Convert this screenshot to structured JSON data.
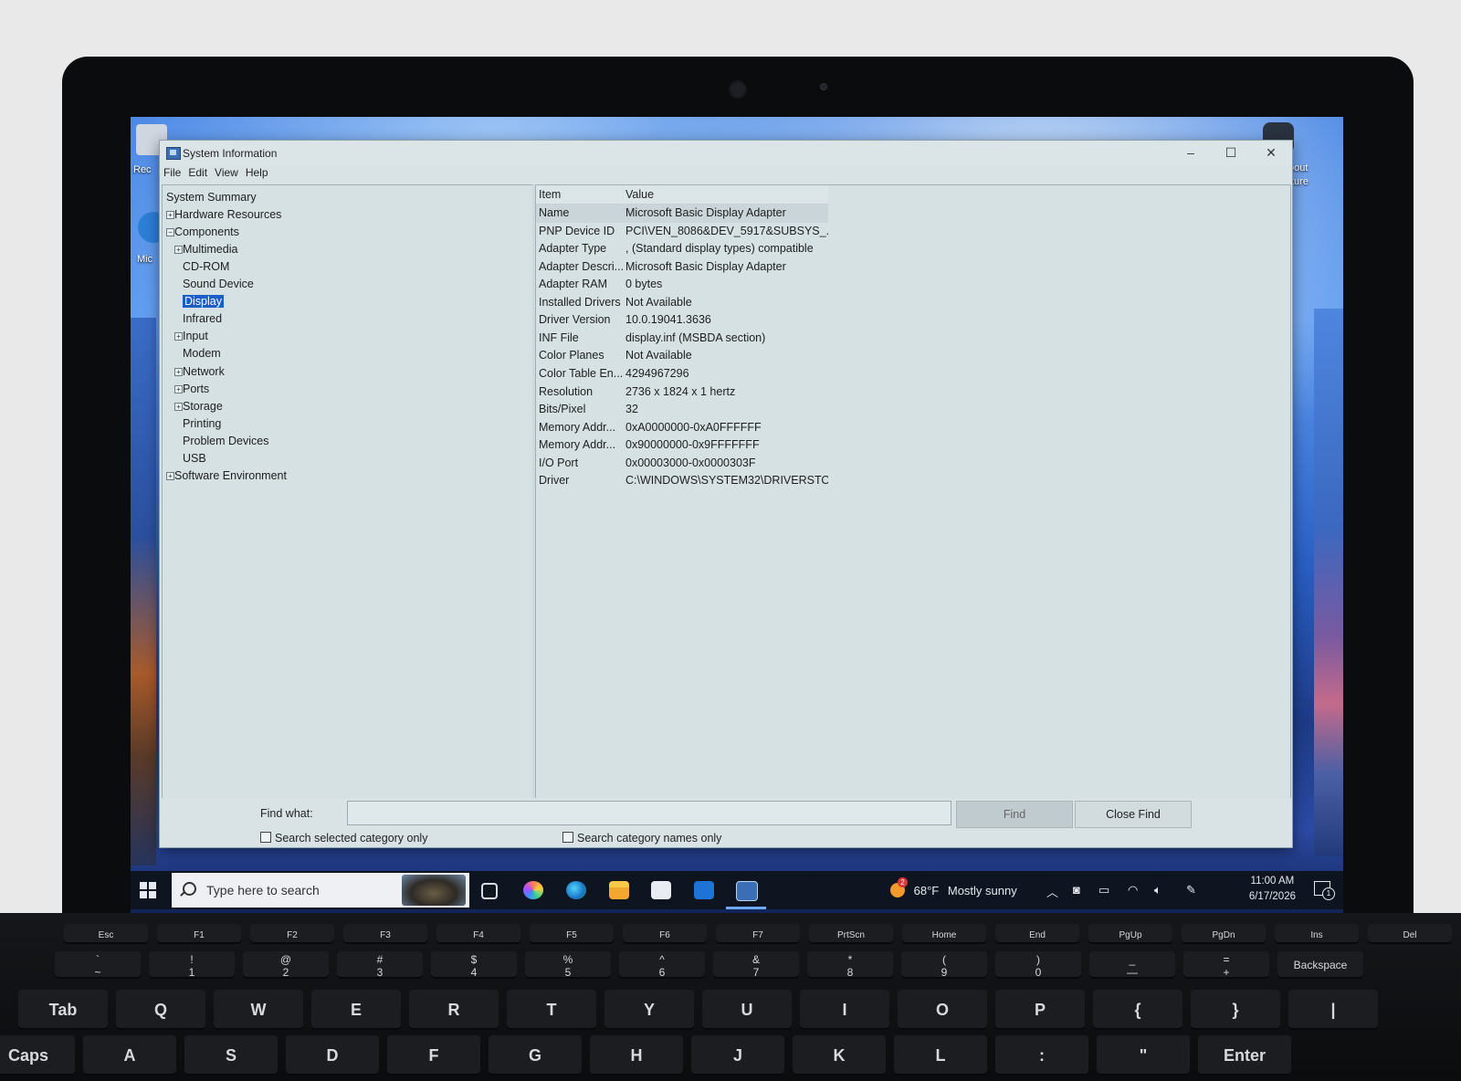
{
  "window": {
    "title": "System Information",
    "menu": [
      "File",
      "Edit",
      "View",
      "Help"
    ],
    "controls": {
      "minimize": "–",
      "maximize": "☐",
      "close": "✕"
    }
  },
  "tree": [
    {
      "label": "System Summary",
      "level": 0,
      "expander": ""
    },
    {
      "label": "Hardware Resources",
      "level": 0,
      "expander": "+"
    },
    {
      "label": "Components",
      "level": 0,
      "expander": "−"
    },
    {
      "label": "Multimedia",
      "level": 1,
      "expander": "+"
    },
    {
      "label": "CD-ROM",
      "level": 1,
      "expander": ""
    },
    {
      "label": "Sound Device",
      "level": 1,
      "expander": ""
    },
    {
      "label": "Display",
      "level": 1,
      "expander": "",
      "selected": true
    },
    {
      "label": "Infrared",
      "level": 1,
      "expander": ""
    },
    {
      "label": "Input",
      "level": 1,
      "expander": "+"
    },
    {
      "label": "Modem",
      "level": 1,
      "expander": ""
    },
    {
      "label": "Network",
      "level": 1,
      "expander": "+"
    },
    {
      "label": "Ports",
      "level": 1,
      "expander": "+"
    },
    {
      "label": "Storage",
      "level": 1,
      "expander": "+"
    },
    {
      "label": "Printing",
      "level": 1,
      "expander": ""
    },
    {
      "label": "Problem Devices",
      "level": 1,
      "expander": ""
    },
    {
      "label": "USB",
      "level": 1,
      "expander": ""
    },
    {
      "label": "Software Environment",
      "level": 0,
      "expander": "+"
    }
  ],
  "details": {
    "columns": [
      "Item",
      "Value"
    ],
    "rows": [
      [
        "Name",
        "Microsoft Basic Display Adapter"
      ],
      [
        "PNP Device ID",
        "PCI\\VEN_8086&DEV_5917&SUBSYS_..."
      ],
      [
        "Adapter Type",
        ", (Standard display types) compatible"
      ],
      [
        "Adapter Descri...",
        "Microsoft Basic Display Adapter"
      ],
      [
        "Adapter RAM",
        "0 bytes"
      ],
      [
        "Installed Drivers",
        "Not Available"
      ],
      [
        "Driver Version",
        "10.0.19041.3636"
      ],
      [
        "INF File",
        "display.inf (MSBDA section)"
      ],
      [
        "Color Planes",
        "Not Available"
      ],
      [
        "Color Table En...",
        "4294967296"
      ],
      [
        "Resolution",
        "2736 x 1824 x 1 hertz"
      ],
      [
        "Bits/Pixel",
        "32"
      ],
      [
        "Memory Addr...",
        "0xA0000000-0xA0FFFFFF"
      ],
      [
        "Memory Addr...",
        "0x90000000-0x9FFFFFFF"
      ],
      [
        "I/O Port",
        "0x00003000-0x0000303F"
      ],
      [
        "Driver",
        "C:\\WINDOWS\\SYSTEM32\\DRIVERSTO..."
      ]
    ]
  },
  "find": {
    "label": "Find what:",
    "value": "",
    "find_button": "Find",
    "close_button": "Close Find",
    "opt_selected": "Search selected category only",
    "opt_names": "Search category names only"
  },
  "taskbar": {
    "search_placeholder": "Type here to search",
    "weather_temp": "68°F",
    "weather_text": "Mostly sunny",
    "weather_badge": "2",
    "time": "11:00 AM",
    "date": "6/17/2026",
    "notification_count": "1",
    "icons": [
      "task-view-icon",
      "copilot-icon",
      "edge-icon",
      "file-explorer-icon",
      "store-icon",
      "outlook-icon",
      "system-information-icon"
    ]
  },
  "desktop": {
    "labels_left": [
      "Rec",
      "Mic"
    ],
    "labels_right": [
      "bout",
      "ture"
    ]
  },
  "keyboard": {
    "fn_row": [
      "Esc",
      "F1",
      "F2",
      "F3",
      "F4",
      "F5",
      "F6",
      "F7",
      "PrtScn",
      "Home",
      "End",
      "PgUp",
      "PgDn",
      "Ins",
      "Del"
    ],
    "num_row": [
      "~",
      "1",
      "2",
      "3",
      "4",
      "5",
      "6",
      "7",
      "8",
      "9",
      "0",
      "—",
      "+",
      "Backspace"
    ],
    "num_row_top": [
      "`",
      "!",
      "@",
      "#",
      "$",
      "%",
      "^",
      "&",
      "*",
      "(",
      ")",
      "_",
      "="
    ],
    "top_row": [
      "Tab",
      "Q",
      "W",
      "E",
      "R",
      "T",
      "Y",
      "U",
      "I",
      "O",
      "P",
      "{",
      "}",
      "|"
    ],
    "home_row": [
      "Caps",
      "A",
      "S",
      "D",
      "F",
      "G",
      "H",
      "J",
      "K",
      "L",
      ":",
      "\"",
      "Enter"
    ]
  }
}
